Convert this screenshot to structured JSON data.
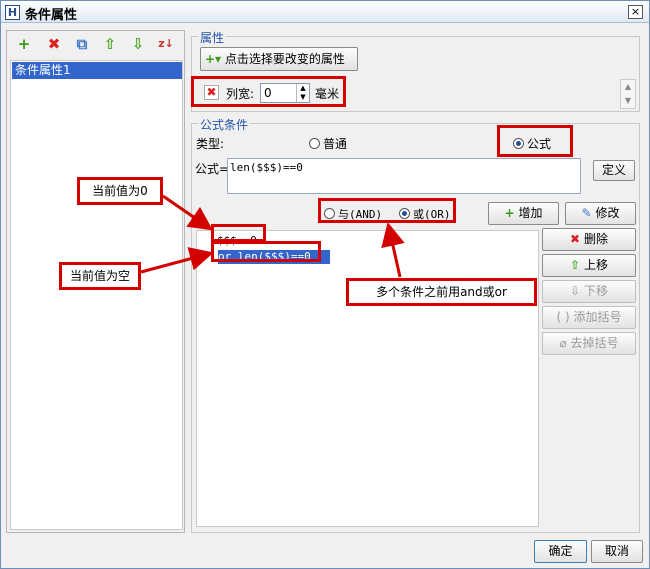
{
  "window": {
    "title": "条件属性",
    "close": "×",
    "app_icon": "H"
  },
  "left": {
    "toolbar_icons": [
      "+",
      "✖",
      "⧉",
      "⇧",
      "⇩",
      "z↓"
    ],
    "items": [
      "条件属性1"
    ]
  },
  "props": {
    "group_label": "属性",
    "select_button": "点击选择要改变的属性",
    "width_label": "列宽:",
    "width_value": "0",
    "unit": "毫米"
  },
  "formula_cond": {
    "group_label": "公式条件",
    "type_label": "类型:",
    "type_normal": "普通",
    "type_formula": "公式",
    "formula_label": "公式=",
    "formula_value": "len($$$)==0",
    "define_button": "定义"
  },
  "logic": {
    "and_label": "与(AND)",
    "or_label": "或(OR)"
  },
  "actions": {
    "add": "增加",
    "modify": "修改",
    "delete": "删除",
    "up": "上移",
    "down": "下移",
    "add_paren": "添加括号",
    "remove_paren": "去掉括号"
  },
  "conditions": [
    {
      "text": "$$$==0"
    },
    {
      "text": "or  len($$$)==0"
    }
  ],
  "annotations": {
    "current_zero": "当前值为0",
    "current_empty": "当前值为空",
    "and_or_note": "多个条件之前用and或or"
  },
  "footer": {
    "ok": "确定",
    "cancel": "取消"
  },
  "colors": {
    "annotation_red": "#d40000",
    "selection_blue": "#3366cc"
  }
}
